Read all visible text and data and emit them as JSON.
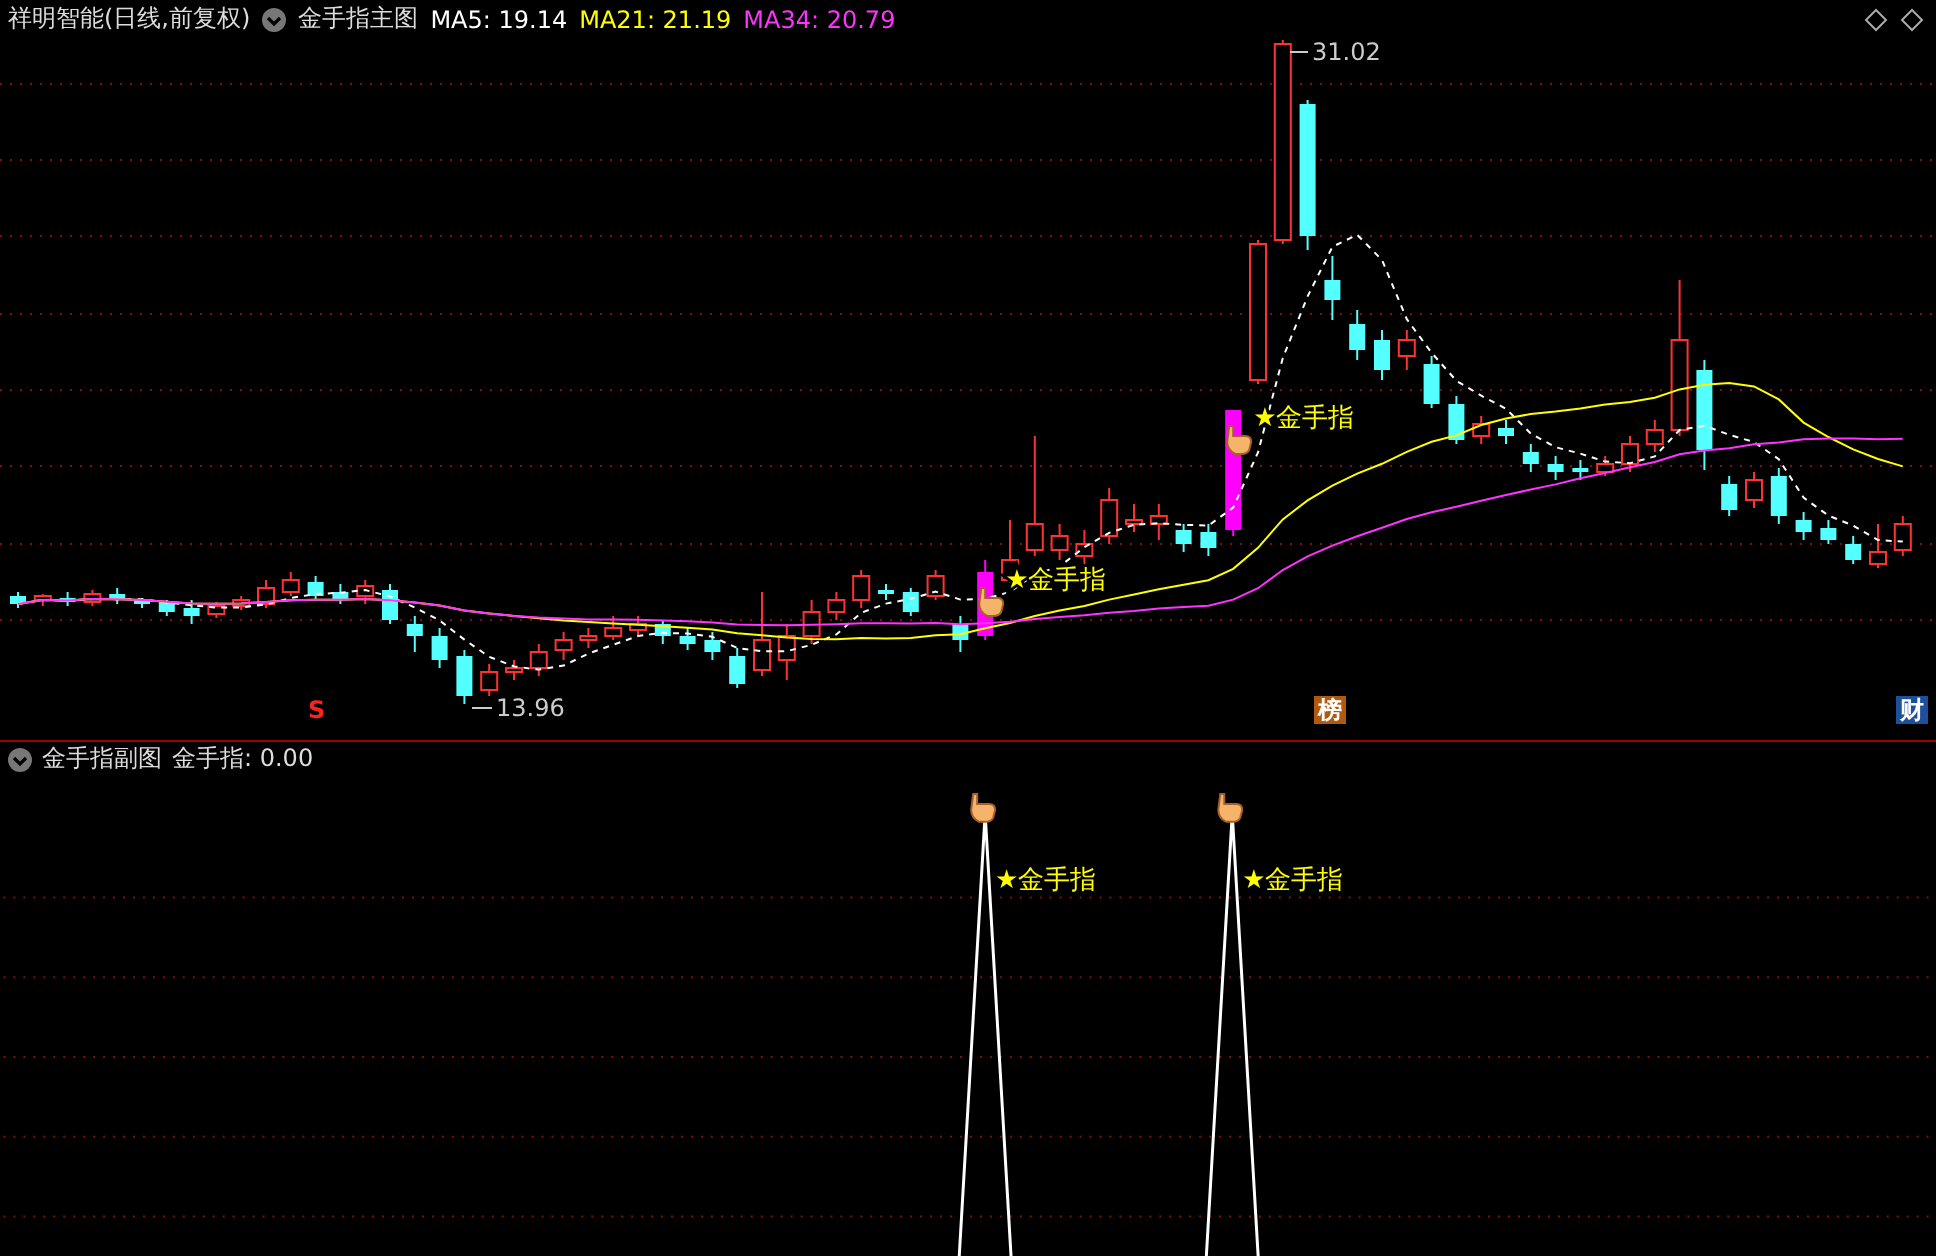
{
  "header": {
    "title": "祥明智能(日线,前复权)",
    "indicator": "金手指主图",
    "ma": [
      {
        "label": "MA5: 19.14",
        "color": "#ffffff"
      },
      {
        "label": "MA21: 21.19",
        "color": "#ffff00"
      },
      {
        "label": "MA34: 20.79",
        "color": "#ff33ff"
      }
    ]
  },
  "main_chart": {
    "high_label": "31.02",
    "low_label": "13.96",
    "signals": [
      {
        "label": "★金手指"
      },
      {
        "label": "★金手指"
      }
    ]
  },
  "event_markers": [
    {
      "label": "S",
      "color": "#ff2020"
    },
    {
      "label": "榜",
      "color": "#b05a10"
    },
    {
      "label": "财",
      "color": "#1e4f9a"
    }
  ],
  "sub_chart": {
    "title": "金手指副图",
    "reading": "金手指: 0.00",
    "signals": [
      {
        "label": "★金手指"
      },
      {
        "label": "★金手指"
      }
    ]
  }
}
